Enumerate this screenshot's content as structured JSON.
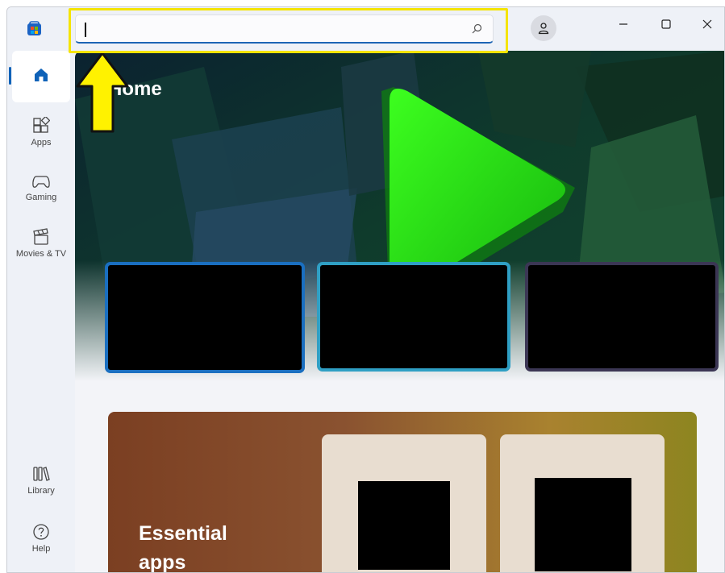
{
  "search": {
    "value": "",
    "placeholder": ""
  },
  "sidebar": {
    "items": [
      {
        "label": ""
      },
      {
        "label": "Apps"
      },
      {
        "label": "Gaming"
      },
      {
        "label": "Movies & TV"
      },
      {
        "label": "Library"
      },
      {
        "label": "Help"
      }
    ]
  },
  "main": {
    "title": "Home",
    "essential": {
      "title": "Essential apps"
    }
  },
  "icons": {
    "app": "store-icon",
    "search": "search-icon",
    "profile": "user-icon",
    "minimize": "minimize-icon",
    "maximize": "maximize-icon",
    "close": "close-icon",
    "home": "home-icon",
    "apps": "apps-icon",
    "gaming": "gamepad-icon",
    "movies": "clapperboard-icon",
    "library": "library-icon",
    "help": "help-icon",
    "annotation": "arrow-up-icon"
  },
  "colors": {
    "accent": "#0f62b8",
    "highlight": "#f5e400"
  }
}
